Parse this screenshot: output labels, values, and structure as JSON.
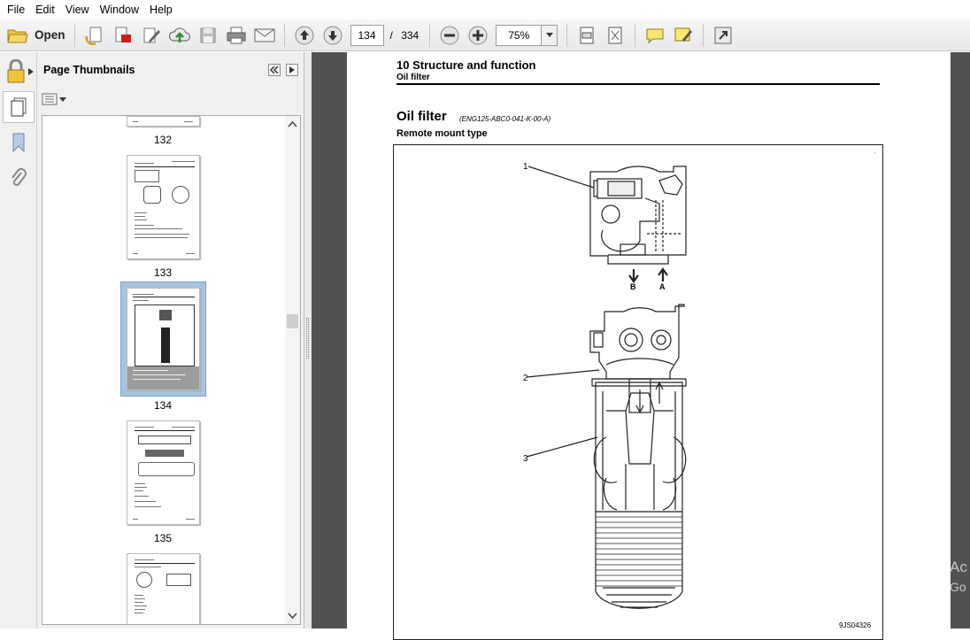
{
  "menu": [
    "File",
    "Edit",
    "View",
    "Window",
    "Help"
  ],
  "toolbar": {
    "open_label": "Open",
    "current_page": "134",
    "page_separator": "/",
    "total_pages": "334",
    "zoom": "75%"
  },
  "thumbnails_panel": {
    "title": "Page Thumbnails",
    "thumbnails": [
      {
        "label": "132"
      },
      {
        "label": "133"
      },
      {
        "label": "134",
        "selected": true
      },
      {
        "label": "135"
      }
    ]
  },
  "document": {
    "section_title": "10 Structure and function",
    "section_subtitle": "Oil filter",
    "heading": "Oil filter",
    "code": "(ENG125-ABC0-041-K-00-A)",
    "subheading": "Remote mount type",
    "figure": {
      "callouts": [
        "1",
        "2",
        "3"
      ],
      "port_labels": [
        "B",
        "A"
      ],
      "figure_id": "9JS04326"
    }
  },
  "watermark": [
    "Ac",
    "Go"
  ],
  "colors": {
    "selection": "#a7c4df",
    "doc_background": "#525252",
    "toolbar_bg": "#ececec"
  }
}
